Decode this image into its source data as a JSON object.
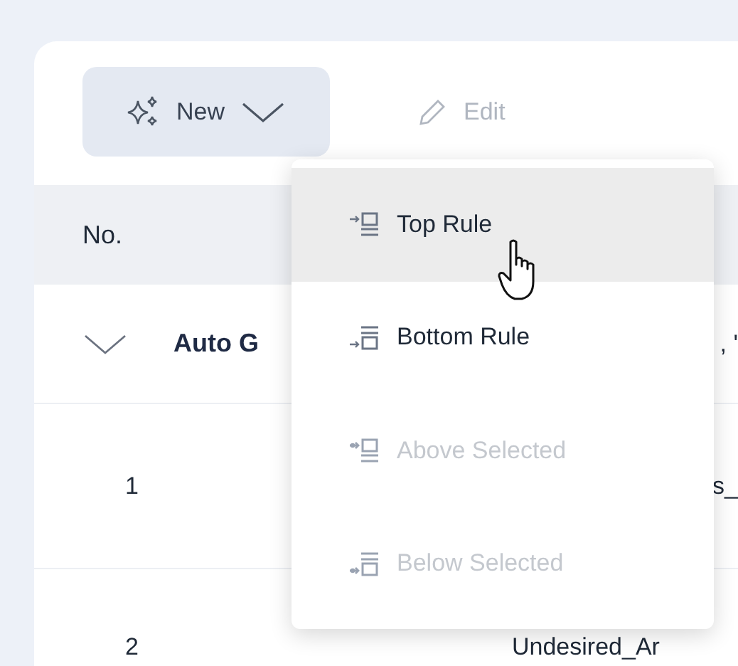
{
  "toolbar": {
    "buttons": [
      {
        "label": "New",
        "kind": "dropdown",
        "disabled": false
      },
      {
        "label": "Edit",
        "kind": "edit",
        "disabled": true
      }
    ]
  },
  "table": {
    "columns": [
      "No."
    ],
    "group": {
      "label": "Auto G",
      "expanded": true,
      "cell_2": ", '"
    },
    "rows": [
      {
        "no": "1",
        "cell_2": "s_"
      },
      {
        "no": "2",
        "cell_2": "Undesired_Ar"
      }
    ]
  },
  "menu": {
    "items": [
      {
        "label": "Top Rule",
        "kind": "top",
        "disabled": false,
        "selected": true
      },
      {
        "label": "Bottom Rule",
        "kind": "bottom",
        "disabled": false,
        "selected": false
      },
      {
        "label": "Above Selected",
        "kind": "above",
        "disabled": true,
        "selected": false
      },
      {
        "label": "Below Selected",
        "kind": "below",
        "disabled": true,
        "selected": false
      }
    ]
  }
}
